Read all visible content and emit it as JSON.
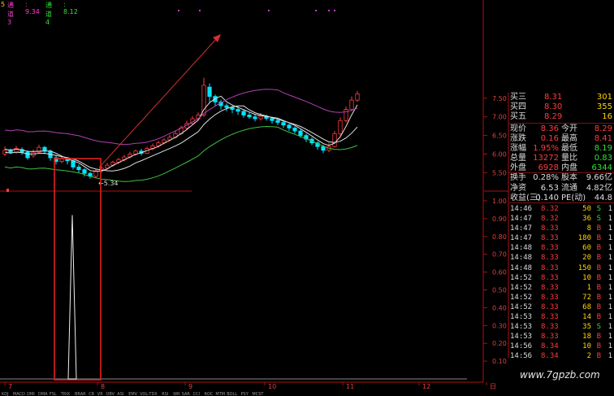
{
  "header": {
    "prefix": "5",
    "ch3_label": "通道3",
    "ch3_value": ": 9.34",
    "ch4_label": "通道4",
    "ch4_value": ": 8.12"
  },
  "price_axis": [
    "7.50",
    "7.00",
    "6.50",
    "6.00",
    "5.50"
  ],
  "vol_axis": [
    "1.00",
    "0.90",
    "0.80",
    "0.70",
    "0.60",
    "0.50",
    "0.40",
    "0.30",
    "0.20",
    "0.10"
  ],
  "low_annotation": "5.34",
  "date_axis": [
    "7",
    "8",
    "9",
    "10",
    "11",
    "12",
    "日"
  ],
  "bottom_tabs": [
    "KDJ",
    "MACD",
    "DMI",
    "DMA",
    "FSL",
    "TRIX",
    "BRAR",
    "CR",
    "VR",
    "OBV",
    "ASI",
    "EMV",
    "VOL-TDX",
    "RSI",
    "WR",
    "SAR",
    "CCI",
    "ROC",
    "MTM",
    "BOLL",
    "PSY",
    "MCST"
  ],
  "order_book": [
    {
      "label": "买三",
      "price": "8.31",
      "vol": "301"
    },
    {
      "label": "买四",
      "price": "8.30",
      "vol": "355"
    },
    {
      "label": "买五",
      "price": "8.29",
      "vol": "16"
    }
  ],
  "quote": [
    {
      "l1": "现价",
      "v1": "8.36",
      "l2": "今开",
      "v2": "8.29"
    },
    {
      "l1": "涨跌",
      "v1": "0.16",
      "l2": "最高",
      "v2": "8.41"
    },
    {
      "l1": "涨幅",
      "v1": "1.95%",
      "l2": "最低",
      "v2": "8.19"
    },
    {
      "l1": "总量",
      "v1": "13272",
      "l2": "量比",
      "v2": "0.83"
    },
    {
      "l1": "外盘",
      "v1": "6928",
      "l2": "内盘",
      "v2": "6344"
    },
    {
      "l1": "换手",
      "v1": "0.28%",
      "l2": "股本",
      "v2": "9.66亿"
    },
    {
      "l1": "净资",
      "v1": "6.53",
      "l2": "流通",
      "v2": "4.82亿"
    },
    {
      "l1": "收益(三)",
      "v1": "0.140",
      "l2": "PE(动)",
      "v2": "44.8"
    }
  ],
  "ticks": [
    {
      "t": "14:46",
      "p": "8.32",
      "v": "50",
      "d": "S",
      "n": "1"
    },
    {
      "t": "14:47",
      "p": "8.32",
      "v": "36",
      "d": "S",
      "n": "1"
    },
    {
      "t": "14:47",
      "p": "8.33",
      "v": "8",
      "d": "B",
      "n": "1"
    },
    {
      "t": "14:47",
      "p": "8.33",
      "v": "180",
      "d": "B",
      "n": "1"
    },
    {
      "t": "14:48",
      "p": "8.33",
      "v": "60",
      "d": "B",
      "n": "1"
    },
    {
      "t": "14:48",
      "p": "8.33",
      "v": "20",
      "d": "B",
      "n": "1"
    },
    {
      "t": "14:48",
      "p": "8.33",
      "v": "150",
      "d": "B",
      "n": "1"
    },
    {
      "t": "14:52",
      "p": "8.33",
      "v": "10",
      "d": "B",
      "n": "1"
    },
    {
      "t": "14:52",
      "p": "8.33",
      "v": "1",
      "d": "B",
      "n": "1"
    },
    {
      "t": "14:52",
      "p": "8.33",
      "v": "72",
      "d": "B",
      "n": "1"
    },
    {
      "t": "14:52",
      "p": "8.33",
      "v": "68",
      "d": "B",
      "n": "1"
    },
    {
      "t": "14:53",
      "p": "8.33",
      "v": "14",
      "d": "B",
      "n": "1"
    },
    {
      "t": "14:53",
      "p": "8.33",
      "v": "35",
      "d": "S",
      "n": "1"
    },
    {
      "t": "14:53",
      "p": "8.33",
      "v": "18",
      "d": "B",
      "n": "1"
    },
    {
      "t": "14:56",
      "p": "8.34",
      "v": "10",
      "d": "B",
      "n": "1"
    },
    {
      "t": "14:56",
      "p": "8.34",
      "v": "2",
      "d": "B",
      "n": "1"
    }
  ],
  "watermark": "www.7gpzb.com",
  "colors": {
    "up": "#ff3b3b",
    "down": "#00e5ff",
    "axis": "#b01010",
    "purple": "#b040b0",
    "green": "#40c040",
    "white": "#e0e0e0"
  },
  "chart_data": {
    "type": "candlestick",
    "price_ylim": [
      5.2,
      7.65
    ],
    "candles": [
      [
        6.0,
        6.1,
        6.2,
        5.95
      ],
      [
        6.1,
        6.05,
        6.15,
        6.0
      ],
      [
        6.05,
        6.15,
        6.22,
        6.0
      ],
      [
        6.12,
        6.05,
        6.18,
        5.98
      ],
      [
        6.05,
        5.9,
        6.1,
        5.85
      ],
      [
        5.95,
        6.05,
        6.12,
        5.9
      ],
      [
        6.05,
        6.18,
        6.25,
        6.02
      ],
      [
        6.18,
        6.08,
        6.22,
        6.0
      ],
      [
        6.08,
        5.9,
        6.12,
        5.82
      ],
      [
        5.9,
        5.8,
        5.98,
        5.72
      ],
      [
        5.8,
        5.88,
        5.95,
        5.75
      ],
      [
        5.88,
        5.82,
        5.92,
        5.72
      ],
      [
        5.82,
        5.65,
        5.88,
        5.58
      ],
      [
        5.65,
        5.58,
        5.72,
        5.5
      ],
      [
        5.58,
        5.48,
        5.62,
        5.4
      ],
      [
        5.48,
        5.4,
        5.52,
        5.34
      ],
      [
        5.4,
        5.55,
        5.6,
        5.36
      ],
      [
        5.55,
        5.62,
        5.68,
        5.5
      ],
      [
        5.62,
        5.7,
        5.76,
        5.58
      ],
      [
        5.7,
        5.78,
        5.82,
        5.66
      ],
      [
        5.78,
        5.85,
        5.9,
        5.74
      ],
      [
        5.85,
        5.92,
        5.98,
        5.8
      ],
      [
        5.92,
        6.0,
        6.06,
        5.88
      ],
      [
        6.0,
        6.08,
        6.12,
        5.96
      ],
      [
        6.08,
        6.02,
        6.14,
        5.96
      ],
      [
        6.02,
        6.15,
        6.2,
        6.0
      ],
      [
        6.15,
        6.22,
        6.28,
        6.1
      ],
      [
        6.22,
        6.3,
        6.36,
        6.18
      ],
      [
        6.3,
        6.38,
        6.42,
        6.26
      ],
      [
        6.38,
        6.45,
        6.52,
        6.34
      ],
      [
        6.45,
        6.55,
        6.62,
        6.42
      ],
      [
        6.55,
        6.7,
        6.76,
        6.52
      ],
      [
        6.7,
        6.82,
        6.9,
        6.66
      ],
      [
        6.82,
        6.95,
        7.02,
        6.78
      ],
      [
        6.95,
        7.05,
        7.12,
        6.9
      ],
      [
        7.05,
        7.85,
        8.05,
        7.0
      ],
      [
        7.8,
        7.55,
        7.9,
        7.4
      ],
      [
        7.55,
        7.4,
        7.6,
        7.3
      ],
      [
        7.4,
        7.3,
        7.46,
        7.2
      ],
      [
        7.3,
        7.25,
        7.36,
        7.15
      ],
      [
        7.25,
        7.2,
        7.3,
        7.1
      ],
      [
        7.2,
        7.15,
        7.28,
        7.05
      ],
      [
        7.15,
        7.05,
        7.2,
        6.98
      ],
      [
        7.05,
        7.0,
        7.12,
        6.95
      ],
      [
        7.0,
        6.95,
        7.06,
        6.88
      ],
      [
        6.95,
        7.02,
        7.1,
        6.9
      ],
      [
        7.02,
        6.96,
        7.06,
        6.9
      ],
      [
        6.96,
        6.9,
        7.0,
        6.82
      ],
      [
        6.9,
        6.85,
        6.95,
        6.78
      ],
      [
        6.85,
        6.78,
        6.9,
        6.7
      ],
      [
        6.78,
        6.7,
        6.82,
        6.62
      ],
      [
        6.7,
        6.62,
        6.74,
        6.55
      ],
      [
        6.62,
        6.5,
        6.66,
        6.44
      ],
      [
        6.5,
        6.4,
        6.55,
        6.32
      ],
      [
        6.4,
        6.3,
        6.45,
        6.24
      ],
      [
        6.3,
        6.2,
        6.34,
        6.12
      ],
      [
        6.2,
        6.1,
        6.25,
        6.02
      ],
      [
        6.1,
        6.2,
        6.3,
        6.05
      ],
      [
        6.2,
        6.55,
        6.62,
        6.18
      ],
      [
        6.55,
        6.9,
        6.98,
        6.5
      ],
      [
        6.9,
        7.2,
        7.28,
        6.85
      ],
      [
        7.2,
        7.45,
        7.55,
        7.15
      ],
      [
        7.45,
        7.62,
        7.7,
        7.4
      ]
    ],
    "volume_ylim": [
      0,
      1.0
    ],
    "volume_peak": 0.92
  }
}
